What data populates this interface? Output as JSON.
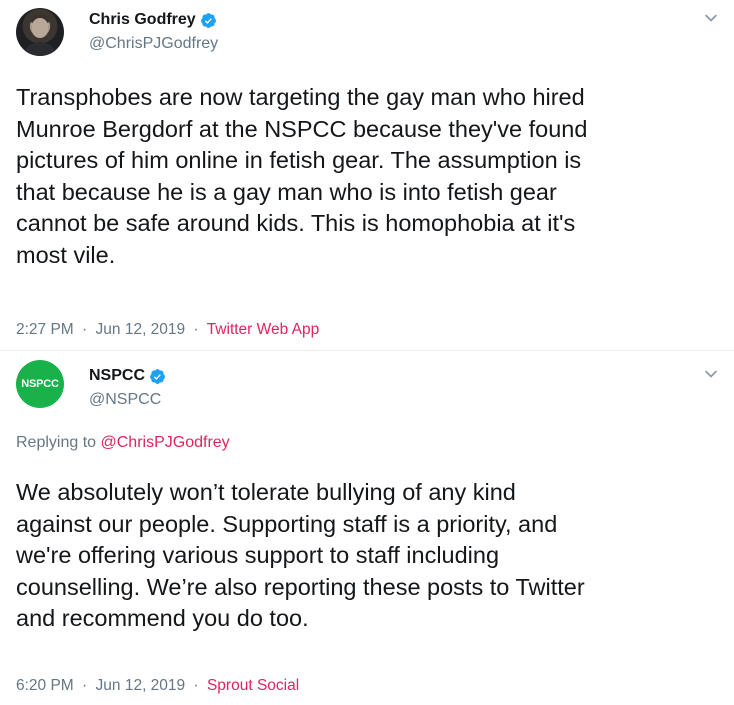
{
  "tweets": [
    {
      "display_name": "Chris Godfrey",
      "handle": "@ChrisPJGodfrey",
      "verified": true,
      "text_lines": [
        "Transphobes are now targeting the gay man who hired",
        "Munroe Bergdorf at the NSPCC because they've found",
        "pictures of him online in fetish gear.  The assumption is",
        "that because he is a gay man who is into fetish gear",
        "cannot be safe around kids. This is homophobia at it's",
        "most vile."
      ],
      "time": "2:27 PM",
      "date": "Jun 12, 2019",
      "separator": "·",
      "source": "Twitter Web App",
      "avatar_icon": "person-photo"
    },
    {
      "display_name": "NSPCC",
      "handle": "@NSPCC",
      "verified": true,
      "avatar_text": "NSPCC",
      "replying_to_label": "Replying to",
      "replying_to_handle": "@ChrisPJGodfrey",
      "text_lines": [
        "We absolutely won’t tolerate bullying of any kind",
        "against our people. Supporting staff is a priority, and",
        "we're offering various support to staff including",
        "counselling. We’re also reporting these posts to Twitter",
        "and recommend you do too."
      ],
      "time": "6:20 PM",
      "date": "Jun 12, 2019",
      "separator": "·",
      "source": "Sprout Social"
    }
  ],
  "colors": {
    "text": "#14171a",
    "secondary": "#657786",
    "link": "#e0245e",
    "verified": "#1da1f2",
    "nspcc_green": "#19b24a",
    "divider": "#e6ecf0"
  },
  "icons": {
    "verified": "verified-badge-icon",
    "chevron": "chevron-down-icon"
  }
}
